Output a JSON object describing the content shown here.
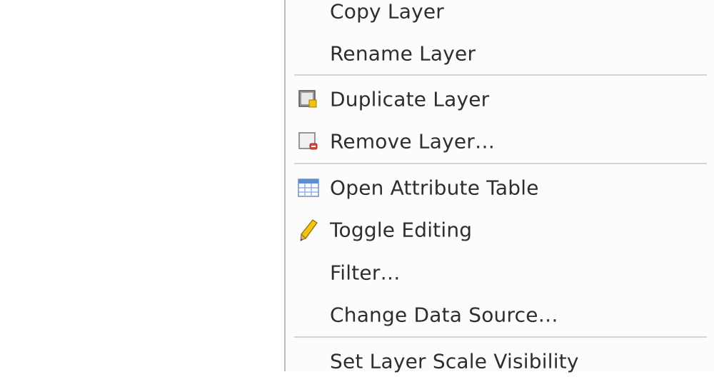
{
  "menu": {
    "items": [
      {
        "label": "Copy Layer",
        "icon": ""
      },
      {
        "label": "Rename Layer",
        "icon": ""
      },
      {
        "label": "Duplicate Layer",
        "icon": "duplicate-layer-icon"
      },
      {
        "label": "Remove Layer…",
        "icon": "remove-layer-icon"
      },
      {
        "label": "Open Attribute Table",
        "icon": "attribute-table-icon"
      },
      {
        "label": "Toggle Editing",
        "icon": "pencil-icon"
      },
      {
        "label": "Filter…",
        "icon": ""
      },
      {
        "label": "Change Data Source…",
        "icon": ""
      },
      {
        "label": "Set Layer Scale Visibility",
        "icon": ""
      }
    ]
  },
  "colors": {
    "menu_background": "#fcfcfc",
    "separator": "#d4d4d4",
    "text": "#2e2e2e",
    "remove_badge": "#e0463b",
    "duplicate_badge": "#f2c40f",
    "table_header": "#5b8fd6"
  }
}
